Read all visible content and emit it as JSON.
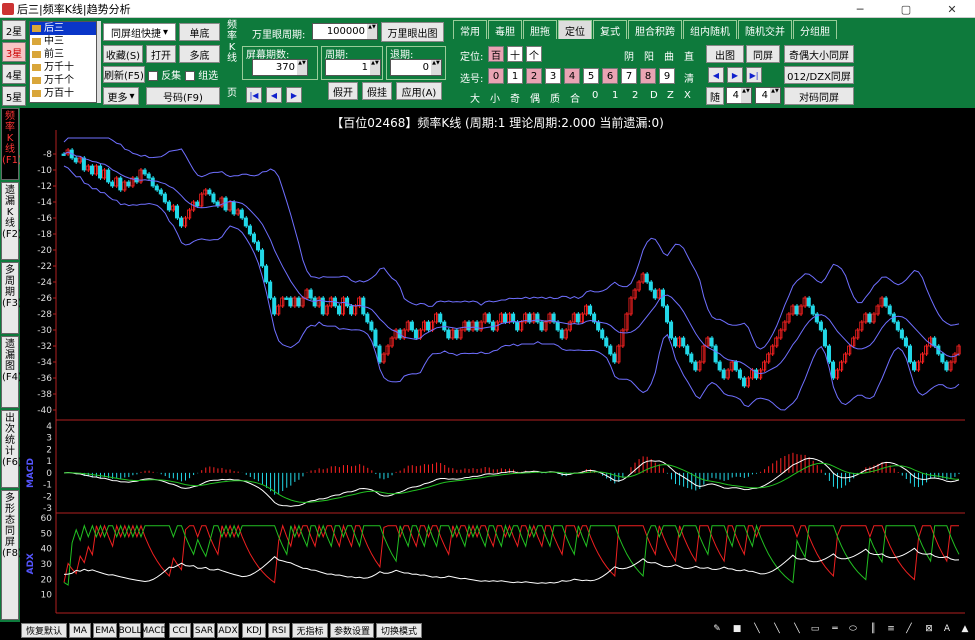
{
  "window": {
    "title": "后三|频率K线|趋势分析",
    "btn_min": "─",
    "btn_max": "▢",
    "btn_close": "✕"
  },
  "stars": [
    "2星",
    "3星",
    "4星",
    "5星"
  ],
  "position_list": [
    "后三",
    "中三",
    "前三",
    "万千十",
    "万千个",
    "万百十"
  ],
  "toolbar": {
    "combo": "同屏组快捷",
    "single": "单底",
    "collect": "收藏(S)",
    "open": "打开",
    "multi": "多底",
    "refresh": "刷新(F5)",
    "reverse": "反集",
    "group_select": "组选",
    "more": "更多",
    "code": "号码(F9)",
    "freq_k": "频率K线",
    "page": "页",
    "wanli_cycle_label": "万里眼周期:",
    "wanli_cycle_value": "100000",
    "wanli_btn": "万里眼出图",
    "screen_periods_label": "屏幕期数:",
    "screen_periods_value": "370",
    "cycle_label": "周期:",
    "cycle_value": "1",
    "back_label": "退期:",
    "back_value": "0",
    "fake_open": "假开",
    "fake_hang": "假挂",
    "apply": "应用(A)"
  },
  "tabs": [
    "常用",
    "毒胆",
    "胆拖",
    "定位",
    "复式",
    "胆合积跨",
    "组内随机",
    "随机交并",
    "分组胆"
  ],
  "active_tab": "定位",
  "position_panel": {
    "dingwei_label": "定位:",
    "dingwei": [
      "百",
      "十",
      "个"
    ],
    "col_heads": [
      "阴",
      "阳",
      "曲",
      "直"
    ],
    "xuanhao_label": "选号:",
    "digits": [
      "0",
      "1",
      "2",
      "3",
      "4",
      "5",
      "6",
      "7",
      "8",
      "9"
    ],
    "qing": "清",
    "bottom_row": [
      "大",
      "小",
      "奇",
      "偶",
      "质",
      "合",
      "0",
      "1",
      "2",
      "D",
      "Z",
      "X"
    ],
    "out_chart": "出图",
    "same_screen": "同屏",
    "odd_even_size": "奇偶大小同屏",
    "dzx": "012/DZX同屏",
    "pair_code": "对码同屏",
    "random_label": "随",
    "random_a": "4",
    "random_b": "4"
  },
  "sidebar": [
    {
      "label": "频率K线(F1)"
    },
    {
      "label": "遗漏K线(F2)"
    },
    {
      "label": "多周期(F3)"
    },
    {
      "label": "遗漏图(F4)"
    },
    {
      "label": "出次统计(F6)"
    },
    {
      "label": "多形态同屏(F8)"
    }
  ],
  "chart_title": "【百位02468】频率K线 (周期:1 理论周期:2.000 当前遗漏:0)",
  "indicator_labels": {
    "macd": "MACD",
    "adx": "ADX"
  },
  "bottom_buttons": [
    "恢复默认",
    "MA",
    "EMA",
    "BOLL",
    "MACD",
    "CCI",
    "SAR",
    "ADX",
    "KDJ",
    "RSI",
    "无指标",
    "参数设置",
    "切换模式"
  ],
  "colors": {
    "up": "#ff2222",
    "down": "#22d8e8",
    "band": "#6f6fff",
    "white": "#ffffff",
    "green": "#22c022",
    "red": "#ee2020"
  },
  "chart_data": [
    {
      "type": "candlestick",
      "title": "【百位02468】频率K线 (周期:1 理论周期:2.000 当前遗漏:0)",
      "ylim": [
        -40,
        -6
      ],
      "yticks": [
        -8,
        -10,
        -12,
        -14,
        -16,
        -18,
        -20,
        -22,
        -24,
        -26,
        -28,
        -30,
        -32,
        -34,
        -36,
        -38,
        -40
      ],
      "series": [
        {
          "kind": "candles",
          "values": [
            -8,
            -7.5,
            -8.5,
            -9,
            -8.5,
            -10,
            -9.5,
            -10.5,
            -9.5,
            -11,
            -10,
            -11.5,
            -12,
            -11,
            -12.5,
            -11.5,
            -12,
            -11,
            -11.5,
            -10,
            -10.5,
            -11,
            -12,
            -12.5,
            -13,
            -14,
            -15,
            -14.5,
            -16,
            -17,
            -16,
            -15,
            -14,
            -14.5,
            -13,
            -12.5,
            -13,
            -14,
            -14.5,
            -13.5,
            -15,
            -14,
            -15.5,
            -15,
            -16,
            -17,
            -18,
            -19,
            -20,
            -22,
            -24,
            -26,
            -28,
            -27,
            -26,
            -26,
            -27,
            -26,
            -27,
            -26,
            -25,
            -26,
            -27,
            -26,
            -28,
            -27,
            -26,
            -27,
            -28,
            -26,
            -27,
            -28,
            -27,
            -26,
            -28,
            -29,
            -30,
            -32,
            -34,
            -33,
            -32,
            -31,
            -30,
            -31,
            -30,
            -29,
            -30,
            -31,
            -30,
            -29,
            -30,
            -29,
            -28,
            -29,
            -30,
            -31,
            -30,
            -31,
            -30,
            -29,
            -30,
            -29,
            -30,
            -29,
            -28,
            -29,
            -30,
            -29,
            -28,
            -29,
            -28,
            -29,
            -30,
            -29,
            -28,
            -29,
            -28,
            -29,
            -30,
            -29,
            -28,
            -29,
            -30,
            -31,
            -30,
            -29,
            -28,
            -29,
            -28,
            -27,
            -28,
            -29,
            -30,
            -31,
            -32,
            -33,
            -34,
            -32,
            -30,
            -28,
            -26,
            -25,
            -24,
            -23,
            -24,
            -25,
            -26,
            -25,
            -27,
            -29,
            -31,
            -32,
            -31,
            -32,
            -33,
            -34,
            -35,
            -34,
            -32,
            -31,
            -32,
            -34,
            -35,
            -36,
            -35,
            -34,
            -35,
            -36,
            -37,
            -36,
            -35,
            -36,
            -35,
            -34,
            -33,
            -32,
            -31,
            -30,
            -29,
            -28,
            -27,
            -28,
            -27,
            -26,
            -27,
            -28,
            -29,
            -30,
            -32,
            -34,
            -36,
            -35,
            -34,
            -33,
            -32,
            -31,
            -30,
            -29,
            -28,
            -29,
            -28,
            -27,
            -26,
            -27,
            -28,
            -29,
            -30,
            -31,
            -32,
            -34,
            -35,
            -34,
            -33,
            -32,
            -31,
            -32,
            -33,
            -34,
            -35,
            -34,
            -33,
            -32
          ]
        },
        {
          "kind": "band",
          "name": "upper"
        },
        {
          "kind": "band",
          "name": "middle"
        },
        {
          "kind": "band",
          "name": "lower"
        }
      ]
    },
    {
      "type": "bar",
      "ylabel": "MACD",
      "ylim": [
        -3,
        4
      ],
      "yticks": [
        4,
        3,
        2,
        1,
        0,
        -1,
        -2,
        -3
      ]
    },
    {
      "type": "line",
      "ylabel": "ADX",
      "ylim": [
        0,
        60
      ],
      "yticks": [
        60,
        50,
        40,
        30,
        20,
        10
      ]
    }
  ]
}
